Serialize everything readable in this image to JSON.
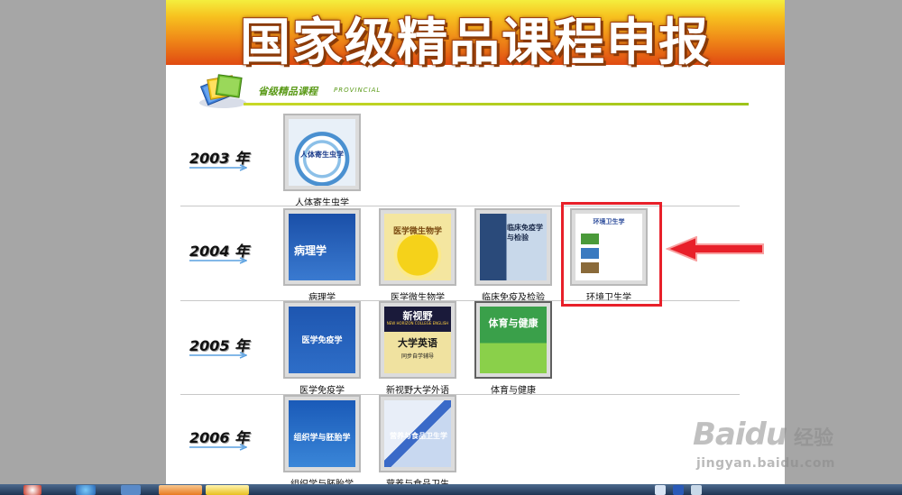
{
  "banner": {
    "title": "国家级精品课程申报"
  },
  "section": {
    "label": "省级精品课程",
    "sub": "PROVINCIAL"
  },
  "rows": [
    {
      "year": "2003 年",
      "books": [
        {
          "caption": "人体寄生虫学",
          "cover_title": "人体寄生虫学"
        }
      ]
    },
    {
      "year": "2004 年",
      "books": [
        {
          "caption": "病理学",
          "cover_title": "病理学"
        },
        {
          "caption": "医学微生物学",
          "cover_title": "医学微生物学"
        },
        {
          "caption": "临床免疫及检验",
          "cover_title": "临床免疫学与检验"
        },
        {
          "caption": "环境卫生学",
          "cover_title": "环境卫生学"
        }
      ]
    },
    {
      "year": "2005 年",
      "books": [
        {
          "caption": "医学免疫学",
          "cover_title": "医学免疫学"
        },
        {
          "caption": "新视野大学外语",
          "cover_title": "大学英语",
          "cover_top": "新视野",
          "cover_en": "NEW HORIZON COLLEGE ENGLISH",
          "cover_sub": "同步自学辅导"
        },
        {
          "caption": "体育与健康",
          "cover_title": "体育与健康"
        }
      ]
    },
    {
      "year": "2006 年",
      "books": [
        {
          "caption": "组织学与胚胎学",
          "cover_title": "组织学与胚胎学"
        },
        {
          "caption": "营养与食品卫生",
          "cover_title": "营养与食品卫生学"
        }
      ]
    }
  ],
  "watermark": {
    "brand": "Baidu",
    "cn": "经验",
    "url": "jingyan.baidu.com"
  }
}
